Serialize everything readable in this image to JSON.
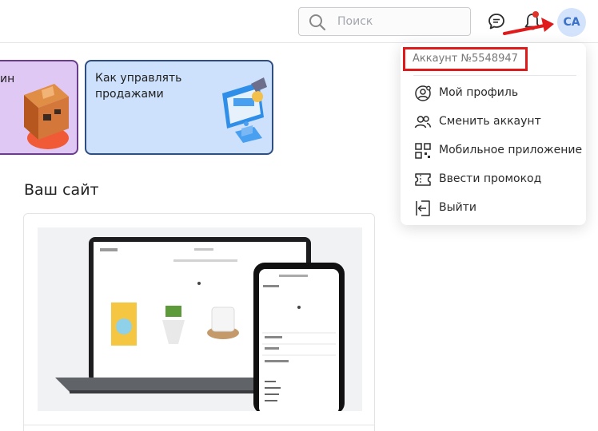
{
  "header": {
    "search_placeholder": "Поиск",
    "avatar_initials": "СА"
  },
  "promo_cards": [
    {
      "title": "ин"
    },
    {
      "title": "Как управлять продажами"
    }
  ],
  "site_section": {
    "title": "Ваш сайт"
  },
  "account_menu": {
    "account_label": "Аккаунт №5548947",
    "items": [
      {
        "label": "Мой профиль",
        "icon": "profile-gear-icon"
      },
      {
        "label": "Сменить аккаунт",
        "icon": "switch-users-icon"
      },
      {
        "label": "Мобильное приложение",
        "icon": "qr-code-icon"
      },
      {
        "label": "Ввести промокод",
        "icon": "ticket-icon"
      },
      {
        "label": "Выйти",
        "icon": "logout-icon"
      }
    ]
  },
  "colors": {
    "annotation_red": "#e01a1a",
    "avatar_bg": "#d3e3fb",
    "card_purple": "#e0c8f5",
    "card_blue": "#cde1fc"
  }
}
